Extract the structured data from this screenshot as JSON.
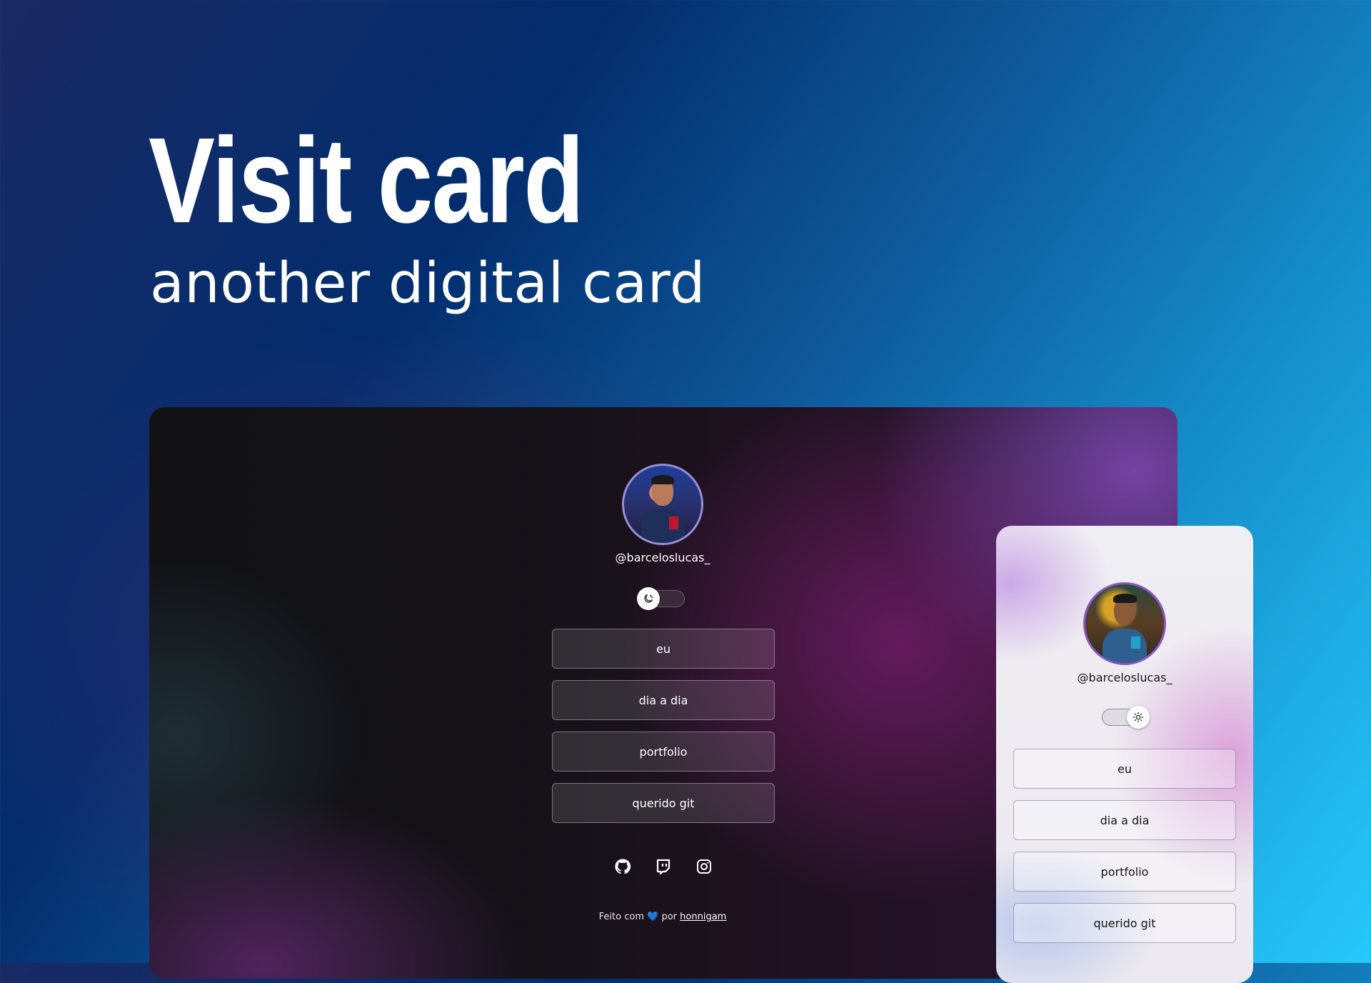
{
  "hero": {
    "title": "Visit card",
    "subtitle": "another digital card"
  },
  "dark_card": {
    "handle": "@barceloslucas_",
    "theme_toggle": {
      "state": "dark",
      "icon": "moon-icon"
    },
    "links": [
      {
        "label": "eu"
      },
      {
        "label": "dia a dia"
      },
      {
        "label": "portfolio"
      },
      {
        "label": "querido git"
      }
    ],
    "social_icons": [
      "github-icon",
      "twitch-icon",
      "instagram-icon"
    ],
    "footer": {
      "prefix": "Feito com",
      "heart": "💙",
      "middle": "por",
      "author": "honnigam"
    }
  },
  "light_card": {
    "handle": "@barceloslucas_",
    "theme_toggle": {
      "state": "light",
      "icon": "sun-icon"
    },
    "links": [
      {
        "label": "eu"
      },
      {
        "label": "dia a dia"
      },
      {
        "label": "portfolio"
      },
      {
        "label": "querido git"
      }
    ]
  },
  "colors": {
    "accent_blue": "#26c8fb",
    "deep_navy": "#032d6e",
    "card_purple": "#701c66",
    "heart_blue": "#3d8ef0"
  }
}
